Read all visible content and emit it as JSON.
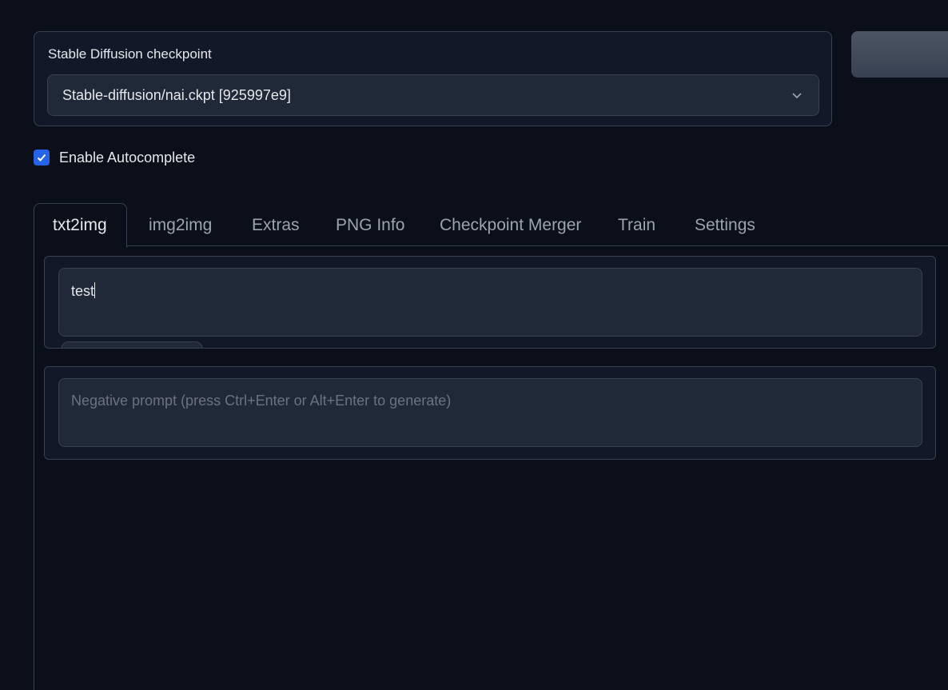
{
  "checkpoint": {
    "label": "Stable Diffusion checkpoint",
    "selected": "Stable-diffusion/nai.ckpt [925997e9]"
  },
  "autocomplete": {
    "label": "Enable Autocomplete",
    "checked": true
  },
  "tabs": [
    {
      "label": "txt2img",
      "active": true
    },
    {
      "label": "img2img"
    },
    {
      "label": "Extras"
    },
    {
      "label": "PNG Info"
    },
    {
      "label": "Checkpoint Merger"
    },
    {
      "label": "Train"
    },
    {
      "label": "Settings"
    }
  ],
  "prompt": {
    "value": "test"
  },
  "negative_prompt": {
    "placeholder": "Negative prompt (press Ctrl+Enter or Alt+Enter to generate)"
  },
  "colors": {
    "accent": "#2563eb",
    "background": "#0b0f19",
    "panel": "#111827",
    "input": "#1f2937",
    "border": "#374151"
  }
}
